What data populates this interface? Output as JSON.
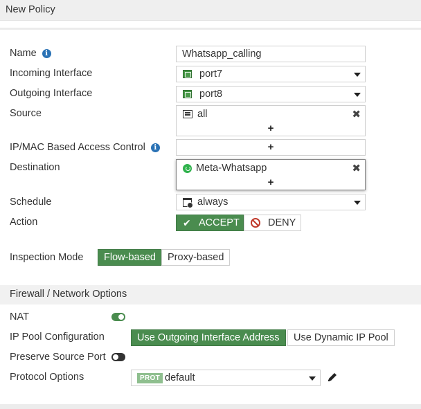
{
  "window": {
    "title": "New Policy"
  },
  "form": {
    "name": {
      "label": "Name",
      "value": "Whatsapp_calling"
    },
    "incoming_interface": {
      "label": "Incoming Interface",
      "value": "port7"
    },
    "outgoing_interface": {
      "label": "Outgoing Interface",
      "value": "port8"
    },
    "source": {
      "label": "Source",
      "value": "all"
    },
    "ip_mac_access": {
      "label": "IP/MAC Based Access Control"
    },
    "destination": {
      "label": "Destination",
      "value": "Meta-Whatsapp"
    },
    "schedule": {
      "label": "Schedule",
      "value": "always"
    },
    "action": {
      "label": "Action",
      "accept_label": "ACCEPT",
      "deny_label": "DENY",
      "selected": "ACCEPT"
    },
    "inspection_mode": {
      "label": "Inspection Mode",
      "options": [
        "Flow-based",
        "Proxy-based"
      ],
      "selected": "Flow-based"
    }
  },
  "firewall_section": {
    "title": "Firewall / Network Options",
    "nat": {
      "label": "NAT",
      "enabled": true
    },
    "ip_pool": {
      "label": "IP Pool Configuration",
      "options": [
        "Use Outgoing Interface Address",
        "Use Dynamic IP Pool"
      ],
      "selected": "Use Outgoing Interface Address"
    },
    "preserve_source_port": {
      "label": "Preserve Source Port",
      "enabled": false
    },
    "protocol_options": {
      "label": "Protocol Options",
      "badge": "PROT",
      "value": "default"
    }
  },
  "symbols": {
    "plus": "+",
    "remove": "✖",
    "check": "✔"
  },
  "colors": {
    "accent_green": "#4a8c4f",
    "info_blue": "#2a72b5",
    "deny_red": "#c0392b"
  }
}
